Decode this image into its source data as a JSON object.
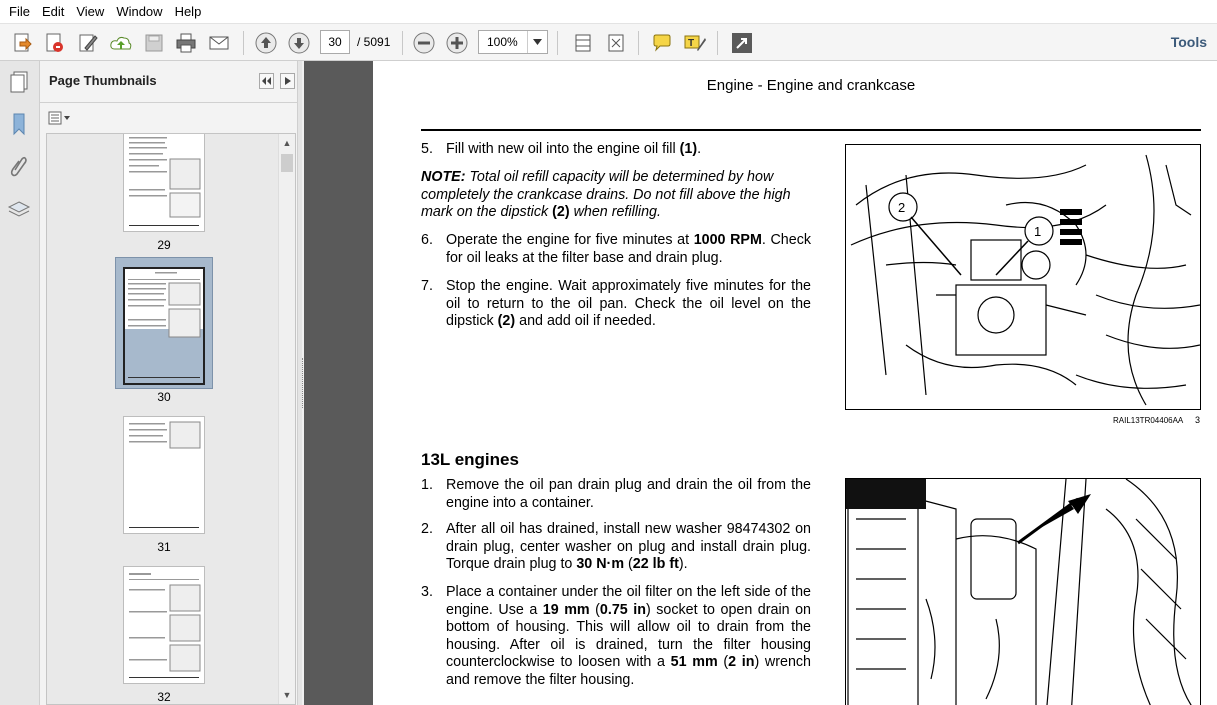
{
  "menu": [
    "File",
    "Edit",
    "View",
    "Window",
    "Help"
  ],
  "toolbar": {
    "page_current": "30",
    "page_total": "/ 5091",
    "zoom": "100%",
    "tools_label": "Tools"
  },
  "panel": {
    "title": "Page Thumbnails",
    "thumbnails": [
      {
        "label": "29"
      },
      {
        "label": "30"
      },
      {
        "label": "31"
      },
      {
        "label": "32"
      }
    ]
  },
  "document": {
    "header": "Engine - Engine and crankcase",
    "step5": "Fill with new oil into the engine oil fill ",
    "step5_bold": "(1)",
    "step5_end": ".",
    "note_lead": "NOTE:",
    "note_body": " Total oil refill capacity will be determined by how completely the crankcase drains. Do not fill above the high mark on the dipstick ",
    "note_bold": "(2)",
    "note_end": " when refilling.",
    "step6_a": "Operate the engine for five minutes at ",
    "step6_bold": "1000 RPM",
    "step6_b": ". Check for oil leaks at the filter base and drain plug.",
    "step7_a": "Stop the engine.  Wait approximately five minutes for the oil to return to the oil pan. Check the oil level on the dipstick ",
    "step7_bold": "(2)",
    "step7_b": " and add oil if needed.",
    "fig1_callout_a": "2",
    "fig1_callout_b": "1",
    "fig1_caption": "RAIL13TR04406AA",
    "fig1_num": "3",
    "section_title": "13L engines",
    "s1": "Remove the oil pan drain plug and drain the oil from the engine into a container.",
    "s2_a": "After all oil has drained, install new washer 98474302 on drain plug, center washer on plug and install drain plug.  Torque drain plug to ",
    "s2_b1": "30 N·m",
    "s2_b2": " (",
    "s2_b3": "22 lb ft",
    "s2_b4": ").",
    "s3_a": "Place a container under the oil filter on the left side of the engine.  Use a ",
    "s3_b1": "19 mm",
    "s3_b2": " (",
    "s3_b3": "0.75 in",
    "s3_b4": ") socket to open drain on bottom of housing.  This will allow oil to drain from the housing.  After oil is drained, turn the filter housing counterclockwise to loosen with a ",
    "s3_b5": "51 mm",
    "s3_b6": " (",
    "s3_b7": "2 in",
    "s3_b8": ") wrench and remove the filter housing.",
    "num5": "5.",
    "num6": "6.",
    "num7": "7.",
    "num1": "1.",
    "num2": "2.",
    "num3": "3."
  }
}
